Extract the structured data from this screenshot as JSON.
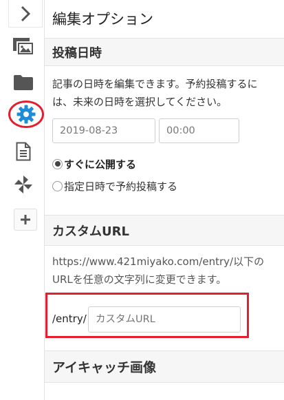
{
  "panel": {
    "title": "編集オプション"
  },
  "sidebar": {
    "items": [
      {
        "name": "toggle",
        "icon": "chevron-right-icon"
      },
      {
        "name": "media",
        "icon": "photos-icon"
      },
      {
        "name": "folder",
        "icon": "folder-icon"
      },
      {
        "name": "settings",
        "icon": "gear-icon",
        "active": true
      },
      {
        "name": "document",
        "icon": "document-icon"
      },
      {
        "name": "pinwheel",
        "icon": "pinwheel-icon"
      },
      {
        "name": "add",
        "icon": "plus-icon"
      }
    ],
    "accent": "#1e8cd8",
    "highlight": "#e41e2e"
  },
  "post_date": {
    "title": "投稿日時",
    "description": "記事の日時を編集できます。予約投稿するには、未来の日時を選択してください。",
    "date_value": "2019-08-23",
    "time_value": "00:00",
    "option_now": "すぐに公開する",
    "option_schedule": "指定日時で予約投稿する",
    "selected": "option_now"
  },
  "custom_url": {
    "title": "カスタムURL",
    "description": "https://www.421miyako.com/entry/以下のURLを任意の文字列に変更できます。",
    "prefix": "/entry/",
    "placeholder": "カスタムURL"
  },
  "eyecatch": {
    "title": "アイキャッチ画像"
  }
}
